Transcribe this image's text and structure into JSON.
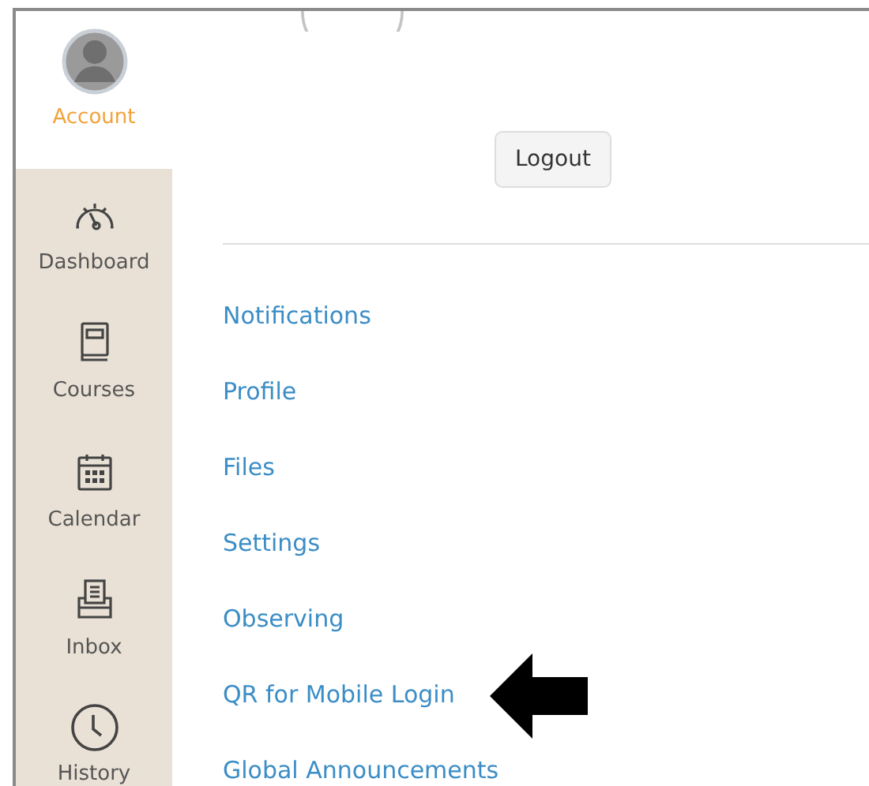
{
  "sidebar": {
    "items": [
      {
        "kind": "account",
        "label": "Account",
        "selected": true
      },
      {
        "kind": "dashboard",
        "label": "Dashboard",
        "selected": false
      },
      {
        "kind": "courses",
        "label": "Courses",
        "selected": false
      },
      {
        "kind": "calendar",
        "label": "Calendar",
        "selected": false
      },
      {
        "kind": "inbox",
        "label": "Inbox",
        "selected": false
      },
      {
        "kind": "history",
        "label": "History",
        "selected": false
      }
    ]
  },
  "account_tray": {
    "logout_button": "Logout",
    "links": [
      {
        "label": "Notifications",
        "pointed": false
      },
      {
        "label": "Profile",
        "pointed": false
      },
      {
        "label": "Files",
        "pointed": false
      },
      {
        "label": "Settings",
        "pointed": false
      },
      {
        "label": "Observing",
        "pointed": false
      },
      {
        "label": "QR for Mobile Login",
        "pointed": true
      },
      {
        "label": "Global Announcements",
        "pointed": false
      }
    ]
  }
}
